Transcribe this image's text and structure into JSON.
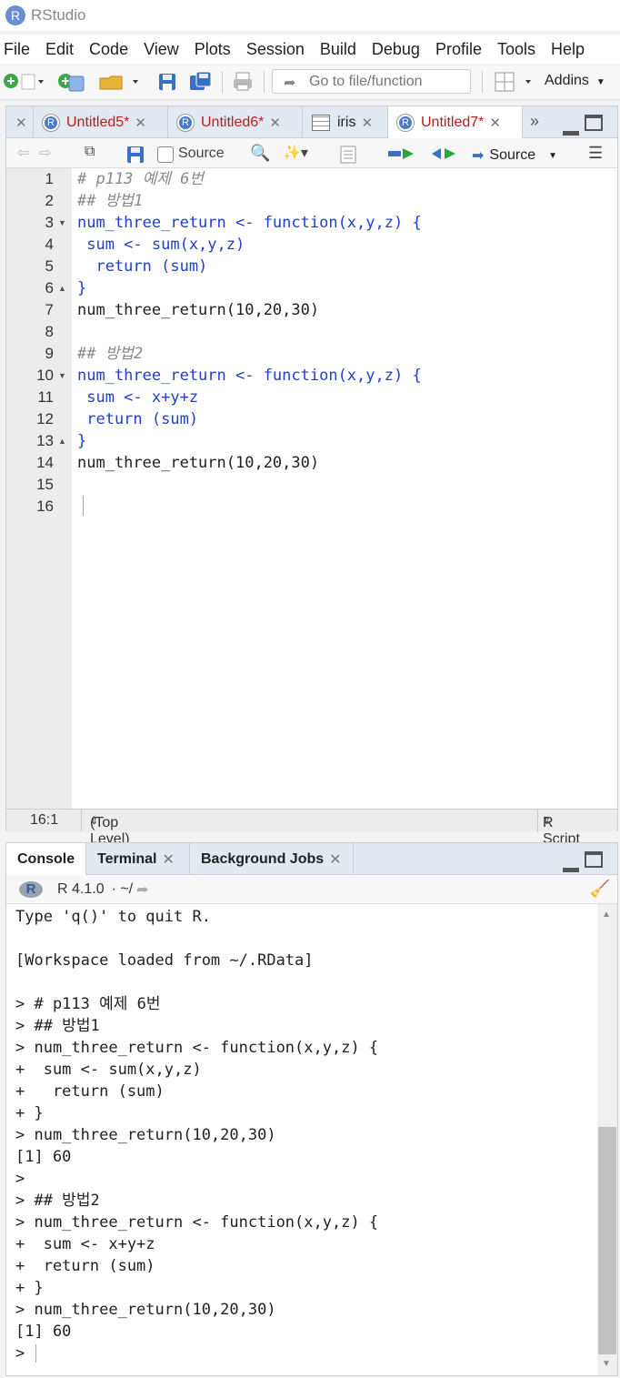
{
  "window": {
    "title": "RStudio",
    "logo": "R"
  },
  "menu": [
    "File",
    "Edit",
    "Code",
    "View",
    "Plots",
    "Session",
    "Build",
    "Debug",
    "Profile",
    "Tools",
    "Help"
  ],
  "toolbar": {
    "goto_placeholder": "Go to file/function",
    "addins_label": "Addins"
  },
  "editor": {
    "tabs": [
      {
        "label": "Untitled5*",
        "icon": "r-file-icon",
        "active": false
      },
      {
        "label": "Untitled6*",
        "icon": "r-file-icon",
        "active": false
      },
      {
        "label": "iris",
        "icon": "data-grid-icon",
        "active": false
      },
      {
        "label": "Untitled7*",
        "icon": "r-file-icon",
        "active": true
      }
    ],
    "toolbar": {
      "source_on_save_label": "Source",
      "source_button_label": "Source"
    },
    "line_numbers": [
      "1",
      "2",
      "3",
      "4",
      "5",
      "6",
      "7",
      "8",
      "9",
      "10",
      "11",
      "12",
      "13",
      "14",
      "15",
      "16"
    ],
    "lines": [
      "# p113 예제 6번",
      "## 방법1",
      "num_three_return <- function(x,y,z) {",
      " sum <- sum(x,y,z)",
      "  return (sum)",
      "}",
      "num_three_return(10,20,30)",
      "",
      "## 방법2",
      "num_three_return <- function(x,y,z) {",
      " sum <- x+y+z",
      " return (sum)",
      "}",
      "num_three_return(10,20,30)",
      "",
      ""
    ],
    "status": {
      "position": "16:1",
      "scope": "(Top Level)",
      "file_type": "R Script"
    }
  },
  "console": {
    "tabs": [
      {
        "label": "Console",
        "active": true
      },
      {
        "label": "Terminal",
        "active": false
      },
      {
        "label": "Background Jobs",
        "active": false
      }
    ],
    "r_version": "R 4.1.0",
    "working_dir": "· ~/",
    "lines": [
      "Type 'q()' to quit R.",
      "",
      "[Workspace loaded from ~/.RData]",
      "",
      "> # p113 예제 6번",
      "> ## 방법1",
      "> num_three_return <- function(x,y,z) {",
      "+  sum <- sum(x,y,z)",
      "+   return (sum)",
      "+ }",
      "> num_three_return(10,20,30)",
      "[1] 60",
      ">",
      "> ## 방법2",
      "> num_three_return <- function(x,y,z) {",
      "+  sum <- x+y+z",
      "+  return (sum)",
      "+ }",
      "> num_three_return(10,20,30)",
      "[1] 60",
      ">"
    ]
  },
  "colors": {
    "accent": "#1f3fcf",
    "unsaved_tab": "#b31e1e",
    "number": "#1a7fd6",
    "comment": "#8a8a8a"
  }
}
